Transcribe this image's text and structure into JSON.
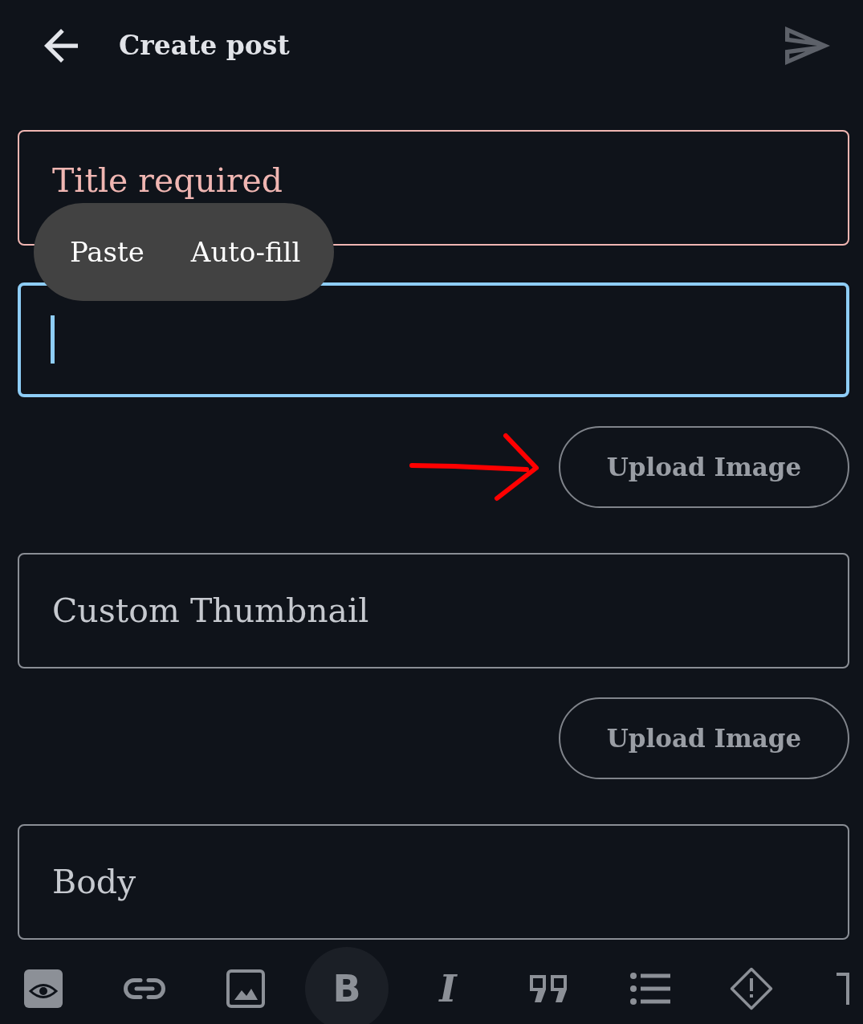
{
  "header": {
    "title": "Create post",
    "send_button": {
      "disabled": true
    }
  },
  "context_menu": {
    "items": [
      "Paste",
      "Auto-fill"
    ]
  },
  "form": [
    {
      "kind": "field",
      "placeholder": "Title required",
      "error": true,
      "focused": false
    },
    {
      "kind": "field",
      "error": false,
      "focused": true
    },
    {
      "kind": "button",
      "label": "Upload Image",
      "annotated": true
    },
    {
      "kind": "field",
      "placeholder": "Custom Thumbnail",
      "error": false,
      "focused": false
    },
    {
      "kind": "button",
      "label": "Upload Image",
      "annotated": false
    },
    {
      "kind": "field",
      "placeholder": "Body",
      "error": false,
      "focused": false
    }
  ],
  "toolbar": [
    {
      "kind": "preview",
      "pressed": false
    },
    {
      "kind": "link",
      "pressed": false
    },
    {
      "kind": "image",
      "pressed": false
    },
    {
      "kind": "bold",
      "glyph": "B",
      "pressed": true
    },
    {
      "kind": "italic",
      "glyph": "I",
      "pressed": false
    },
    {
      "kind": "quote",
      "pressed": false
    },
    {
      "kind": "list",
      "pressed": false
    },
    {
      "kind": "warning",
      "pressed": false
    },
    {
      "kind": "clipped",
      "pressed": false
    }
  ]
}
